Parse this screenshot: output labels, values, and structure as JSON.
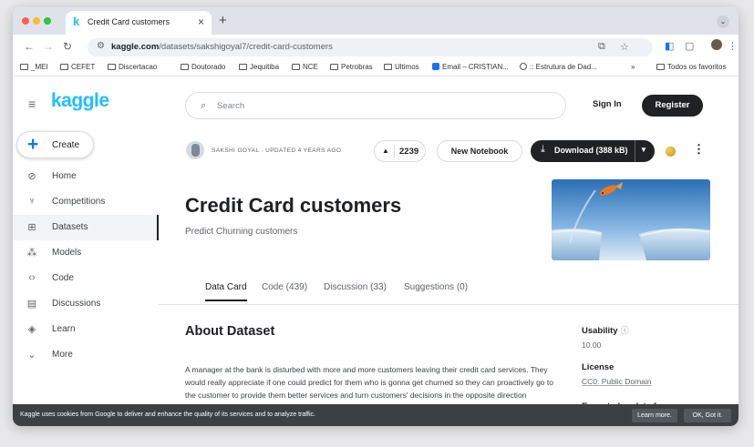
{
  "browser": {
    "tab_title": "Credit Card customers",
    "tab_favicon": "k",
    "new_tab_glyph": "+",
    "url_host": "kaggle.com",
    "url_path": "/datasets/sakshigoyal7/credit-card-customers",
    "bookmarks": [
      {
        "label": "_MEI"
      },
      {
        "label": "CEFET"
      },
      {
        "label": "Discertacao"
      },
      {
        "label": "Doutorado"
      },
      {
        "label": "Jequitiba"
      },
      {
        "label": "NCE"
      },
      {
        "label": "Petrobras"
      },
      {
        "label": "Ultimos"
      },
      {
        "label": "Email – CRISTIAN..."
      },
      {
        "label": ":: Estrutura de Dad..."
      }
    ],
    "bookmarks_overflow": "»",
    "all_bookmarks": "Todos os favoritos"
  },
  "sidebar": {
    "logo": "kaggle",
    "create_label": "Create",
    "items": [
      {
        "label": "Home",
        "icon": "compass-icon"
      },
      {
        "label": "Competitions",
        "icon": "trophy-icon"
      },
      {
        "label": "Datasets",
        "icon": "table-icon",
        "active": true
      },
      {
        "label": "Models",
        "icon": "models-icon"
      },
      {
        "label": "Code",
        "icon": "code-icon"
      },
      {
        "label": "Discussions",
        "icon": "discussions-icon"
      },
      {
        "label": "Learn",
        "icon": "graduation-cap-icon"
      },
      {
        "label": "More",
        "icon": "chevron-down-icon"
      }
    ]
  },
  "header": {
    "search_placeholder": "Search",
    "signin_label": "Sign In",
    "register_label": "Register"
  },
  "dataset": {
    "author_meta": "SAKSHI GOYAL · UPDATED 4 YEARS AGO",
    "upvotes": "2239",
    "new_notebook_label": "New Notebook",
    "download_label": "Download (388 kB)",
    "title": "Credit Card customers",
    "subtitle": "Predict Churning customers",
    "tabs": [
      {
        "label": "Data Card",
        "active": true
      },
      {
        "label": "Code (439)"
      },
      {
        "label": "Discussion (33)"
      },
      {
        "label": "Suggestions (0)"
      }
    ],
    "about_title": "About Dataset",
    "about_text": "A manager at the bank is disturbed with more and more customers leaving their credit card services. They would really appreciate if one could predict for them who is gonna get churned so they can proactively go to the customer to provide them better services and turn customers' decisions in the opposite direction",
    "usability_label": "Usability",
    "usability_value": "10.00",
    "license_label": "License",
    "license_value": "CC0: Public Domain",
    "next_label": "Expected update frequency"
  },
  "cookie": {
    "text": "Kaggle uses cookies from Google to deliver and enhance the quality of its services and to analyze traffic.",
    "learn_more": "Learn more.",
    "ok": "OK, Got it."
  },
  "colors": {
    "kaggle_blue": "#20beff",
    "dark_button": "#202124",
    "cookie_bar": "#3c4043"
  }
}
